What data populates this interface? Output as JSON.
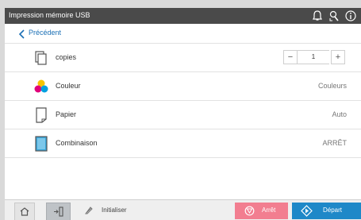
{
  "header": {
    "title": "Impression mémoire USB"
  },
  "nav": {
    "back_label": "Précédent"
  },
  "settings": {
    "copies": {
      "label": "copies",
      "value": "1",
      "minus": "−",
      "plus": "+"
    },
    "color": {
      "label": "Couleur",
      "value": "Couleurs"
    },
    "paper": {
      "label": "Papier",
      "value": "Auto"
    },
    "combine": {
      "label": "Combinaison",
      "value": "ARRÊT"
    }
  },
  "footer": {
    "reset_label": "Initialiser",
    "stop_label": "Arrêt",
    "start_label": "Départ"
  },
  "icons": {
    "header": [
      "bell-icon",
      "tool-icon",
      "info-icon"
    ],
    "rows": [
      "copies-icon",
      "color-icon",
      "paper-icon",
      "combine-icon"
    ],
    "footer": [
      "home-icon",
      "panel-icon",
      "eraser-icon",
      "stop-icon",
      "start-icon"
    ]
  },
  "colors": {
    "title_bar": "#4a4a4a",
    "back_link": "#1a6fb5",
    "stop_button": "#f27e90",
    "start_button": "#1e88c8"
  }
}
